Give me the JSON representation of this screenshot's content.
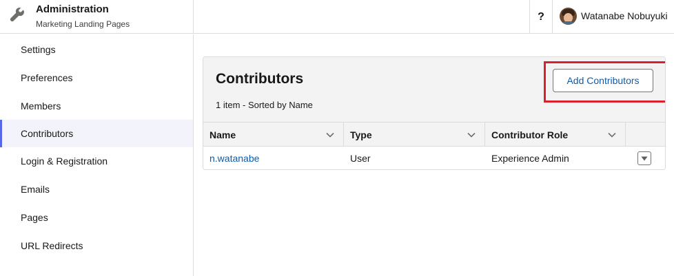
{
  "header": {
    "app_title": "Administration",
    "app_subtitle": "Marketing Landing Pages",
    "help_label": "?",
    "user_name": "Watanabe Nobuyuki"
  },
  "sidebar": {
    "items": [
      {
        "label": "Settings",
        "active": false
      },
      {
        "label": "Preferences",
        "active": false
      },
      {
        "label": "Members",
        "active": false
      },
      {
        "label": "Contributors",
        "active": true
      },
      {
        "label": "Login & Registration",
        "active": false
      },
      {
        "label": "Emails",
        "active": false
      },
      {
        "label": "Pages",
        "active": false
      },
      {
        "label": "URL Redirects",
        "active": false
      }
    ]
  },
  "main": {
    "title": "Contributors",
    "meta": "1 item - Sorted by Name",
    "add_button": "Add Contributors",
    "columns": [
      "Name",
      "Type",
      "Contributor Role"
    ],
    "rows": [
      {
        "name": "n.watanabe",
        "type": "User",
        "role": "Experience Admin"
      }
    ]
  },
  "colors": {
    "link": "#0b5cab",
    "active_nav_border": "#5867e8",
    "highlight_box": "#d9202e"
  }
}
